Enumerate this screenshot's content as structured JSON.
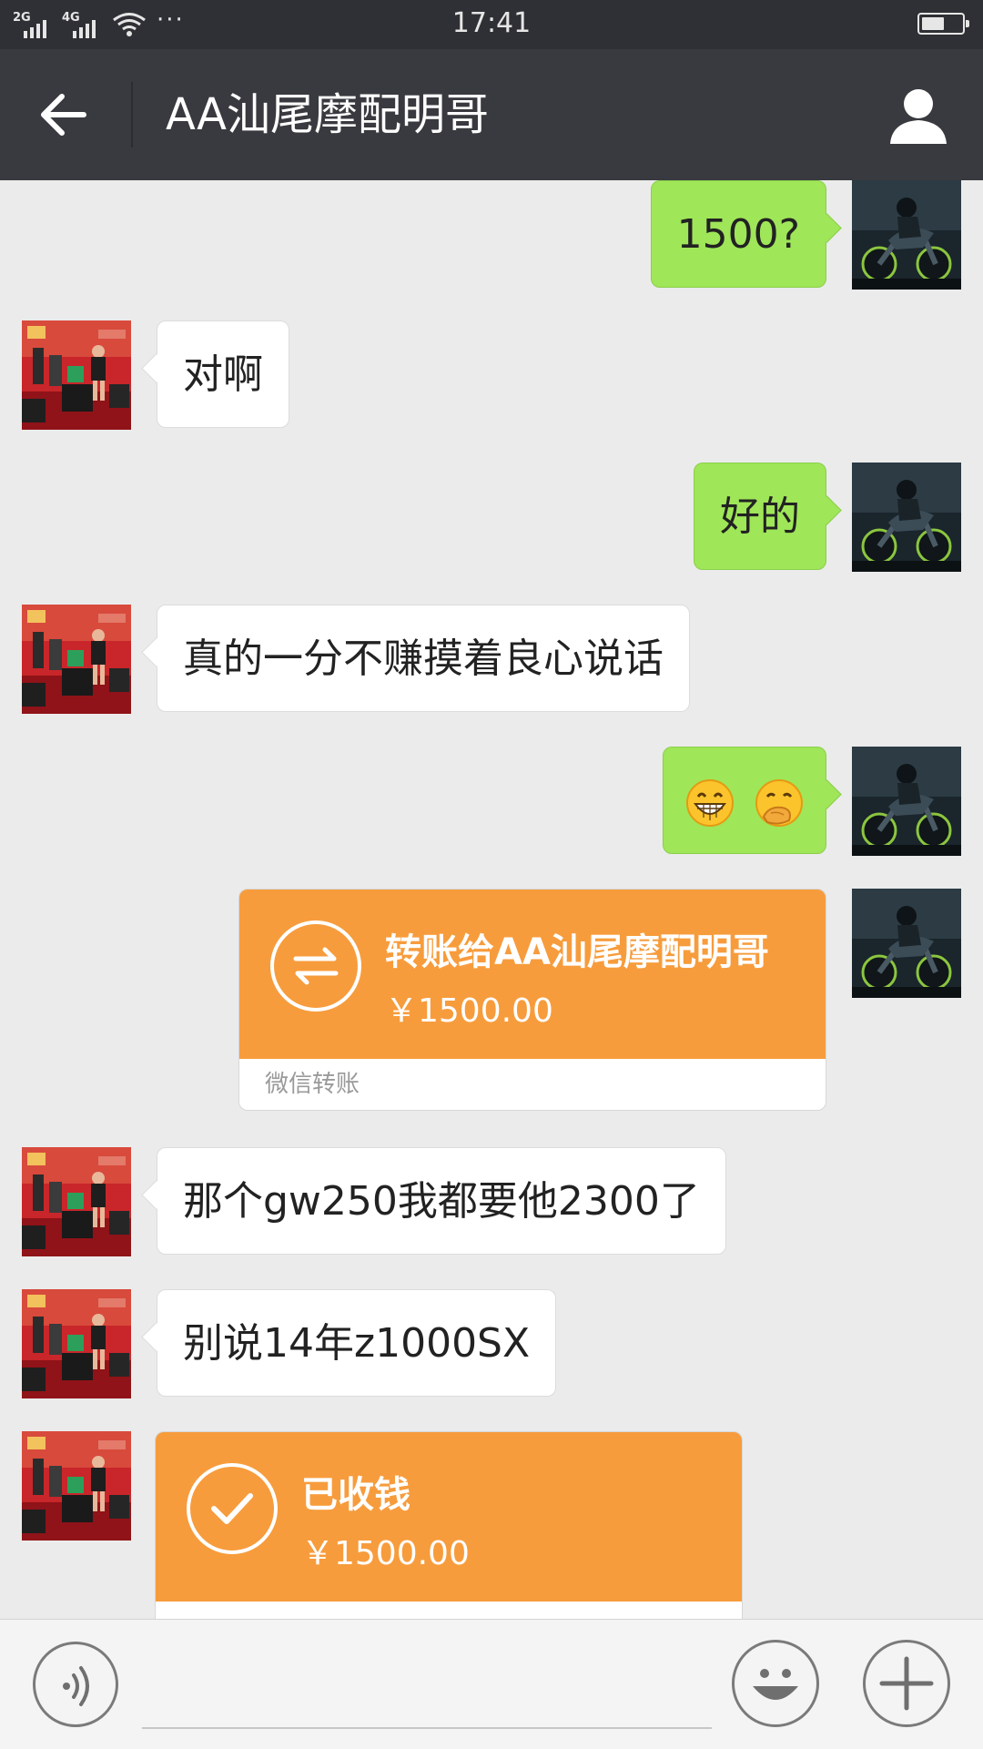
{
  "status_bar": {
    "network_1": "2G",
    "network_2": "4G",
    "more": "···",
    "time": "17:41",
    "battery_level": 0.55
  },
  "nav": {
    "back_icon": "arrow-left-icon",
    "title": "AA汕尾摩配明哥",
    "profile_icon": "person-icon"
  },
  "messages": [
    {
      "from": "me",
      "type": "text",
      "text": "1500?"
    },
    {
      "from": "other",
      "type": "text",
      "text": "对啊"
    },
    {
      "from": "me",
      "type": "text",
      "text": "好的"
    },
    {
      "from": "other",
      "type": "text",
      "text": "真的一分不赚摸着良心说话"
    },
    {
      "from": "me",
      "type": "emoji",
      "emojis": [
        "grinning-face-icon",
        "hand-over-mouth-face-icon"
      ]
    },
    {
      "from": "me",
      "type": "transfer",
      "title": "转账给AA汕尾摩配明哥",
      "amount": "￥1500.00",
      "footer": "微信转账"
    },
    {
      "from": "other",
      "type": "text",
      "text": "那个gw250我都要他2300了"
    },
    {
      "from": "other",
      "type": "text",
      "text": "别说14年z1000SX"
    },
    {
      "from": "other",
      "type": "received",
      "title": "已收钱",
      "amount": "￥1500.00"
    }
  ],
  "input_bar": {
    "voice_icon": "voice-icon",
    "input_value": "",
    "emoji_icon": "smiley-icon",
    "plus_icon": "plus-icon"
  },
  "colors": {
    "nav_bg": "#393a3f",
    "status_bg": "#2f3035",
    "chat_bg": "#ebebeb",
    "outgoing_bubble": "#9fe658",
    "transfer_orange": "#f79c3c"
  }
}
